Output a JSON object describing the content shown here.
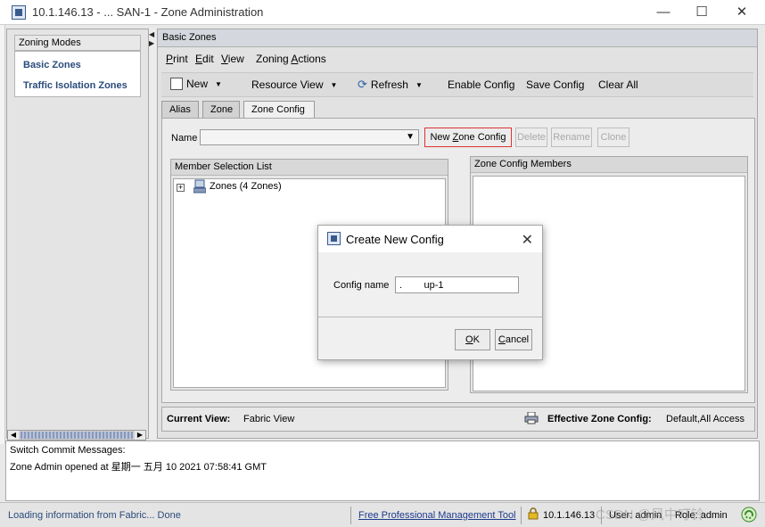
{
  "window": {
    "title": "10.1.146.13 - ... SAN-1 - Zone Administration",
    "minimize": "—",
    "maximize": "☐",
    "close": "✕"
  },
  "left": {
    "header": "Zoning Modes",
    "items": [
      "Basic Zones",
      "Traffic Isolation Zones"
    ]
  },
  "right": {
    "title": "Basic Zones",
    "menu": [
      "Print",
      "Edit",
      "View",
      "Zoning Actions"
    ],
    "toolbar": {
      "new": "New",
      "resource_view": "Resource View",
      "refresh": "Refresh",
      "enable_config": "Enable Config",
      "save_config": "Save Config",
      "clear_all": "Clear All"
    },
    "tabs": [
      "Alias",
      "Zone",
      "Zone Config"
    ],
    "name_label": "Name",
    "name_value": "",
    "buttons": {
      "new_zone_config": "New Zone Config",
      "delete": "Delete",
      "rename": "Rename",
      "clone": "Clone"
    },
    "member_list": {
      "title": "Member Selection List",
      "tree_root": "Zones (4 Zones)"
    },
    "config_members": {
      "title": "Zone Config Members"
    },
    "current_view_label": "Current View:",
    "current_view_value": "Fabric View",
    "effective_label": "Effective Zone Config:",
    "effective_value": "Default,All Access"
  },
  "messages": {
    "title": "Switch Commit Messages:",
    "line1": "Zone Admin opened at 星期一 五月 10 2021 07:58:41 GMT"
  },
  "statusbar": {
    "loading": "Loading information from Fabric... Done",
    "tool_link": "Free Professional Management Tool",
    "ip": "10.1.146.13",
    "user": "User: admin",
    "role": "Role: admin",
    "watermark": "CSDN @风中叮铃"
  },
  "dialog": {
    "title": "Create New Config",
    "field_label": "Config name",
    "field_value": ".        up-1",
    "ok": "OK",
    "cancel": "Cancel"
  },
  "colors": {
    "link_blue": "#2a4b7c",
    "highlight_red": "#dd3333"
  }
}
